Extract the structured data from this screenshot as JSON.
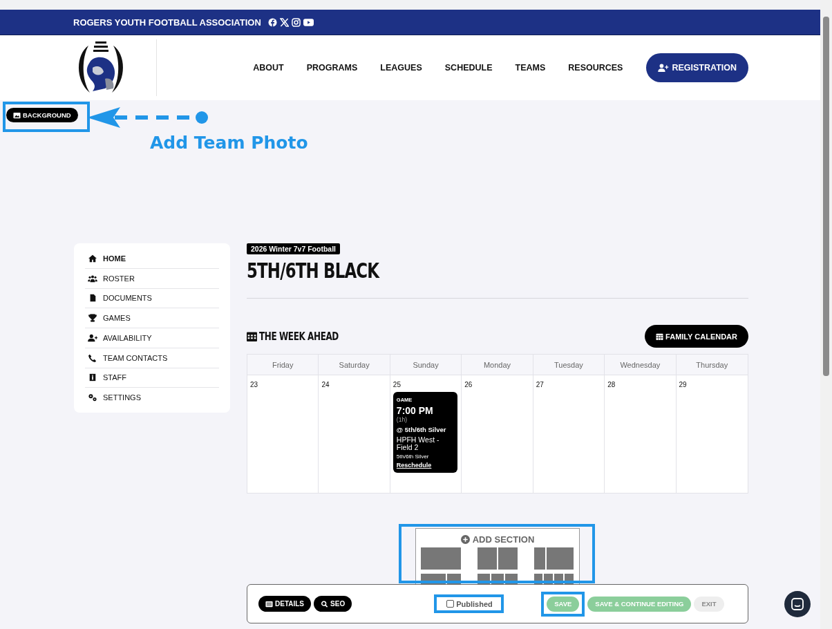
{
  "banner": {
    "title": "ROGERS YOUTH FOOTBALL ASSOCIATION"
  },
  "nav": {
    "items": [
      "ABOUT",
      "PROGRAMS",
      "LEAGUES",
      "SCHEDULE",
      "TEAMS",
      "RESOURCES"
    ],
    "cta": "REGISTRATION"
  },
  "background_button": "BACKGROUND",
  "annotation": "Add Team Photo",
  "sidebar": {
    "items": [
      {
        "label": "HOME",
        "selected": true
      },
      {
        "label": "ROSTER",
        "selected": false
      },
      {
        "label": "DOCUMENTS",
        "selected": false
      },
      {
        "label": "GAMES",
        "selected": false
      },
      {
        "label": "AVAILABILITY",
        "selected": false
      },
      {
        "label": "TEAM CONTACTS",
        "selected": false
      },
      {
        "label": "STAFF",
        "selected": false
      },
      {
        "label": "SETTINGS",
        "selected": false
      }
    ]
  },
  "team": {
    "season": "2026 Winter 7v7 Football",
    "name": "5TH/6TH BLACK"
  },
  "week": {
    "title": "THE WEEK AHEAD",
    "calendar_button": "FAMILY CALENDAR",
    "days": [
      {
        "name": "Friday",
        "date": "23"
      },
      {
        "name": "Saturday",
        "date": "24"
      },
      {
        "name": "Sunday",
        "date": "25",
        "events": [
          {
            "type": "GAME",
            "time": "7:00 PM",
            "duration": "(1h)",
            "opponent": "@ 5th/6th Silver",
            "location": "HPFH West - Field 2",
            "team": "5th/6th Silver",
            "action": "Reschedule"
          }
        ]
      },
      {
        "name": "Monday",
        "date": "26"
      },
      {
        "name": "Tuesday",
        "date": "27"
      },
      {
        "name": "Wednesday",
        "date": "28"
      },
      {
        "name": "Thursday",
        "date": "29"
      }
    ]
  },
  "add_section": {
    "label": "ADD SECTION"
  },
  "toolbar": {
    "buttons": [
      "DETAILS",
      "SEO"
    ],
    "published": {
      "label": "Published",
      "checked": false
    },
    "actions": [
      {
        "label": "SAVE",
        "kind": "save",
        "disabled": true
      },
      {
        "label": "SAVE & CONTINUE EDITING",
        "kind": "save",
        "disabled": true
      },
      {
        "label": "EXIT",
        "kind": "exit",
        "disabled": true
      }
    ]
  }
}
